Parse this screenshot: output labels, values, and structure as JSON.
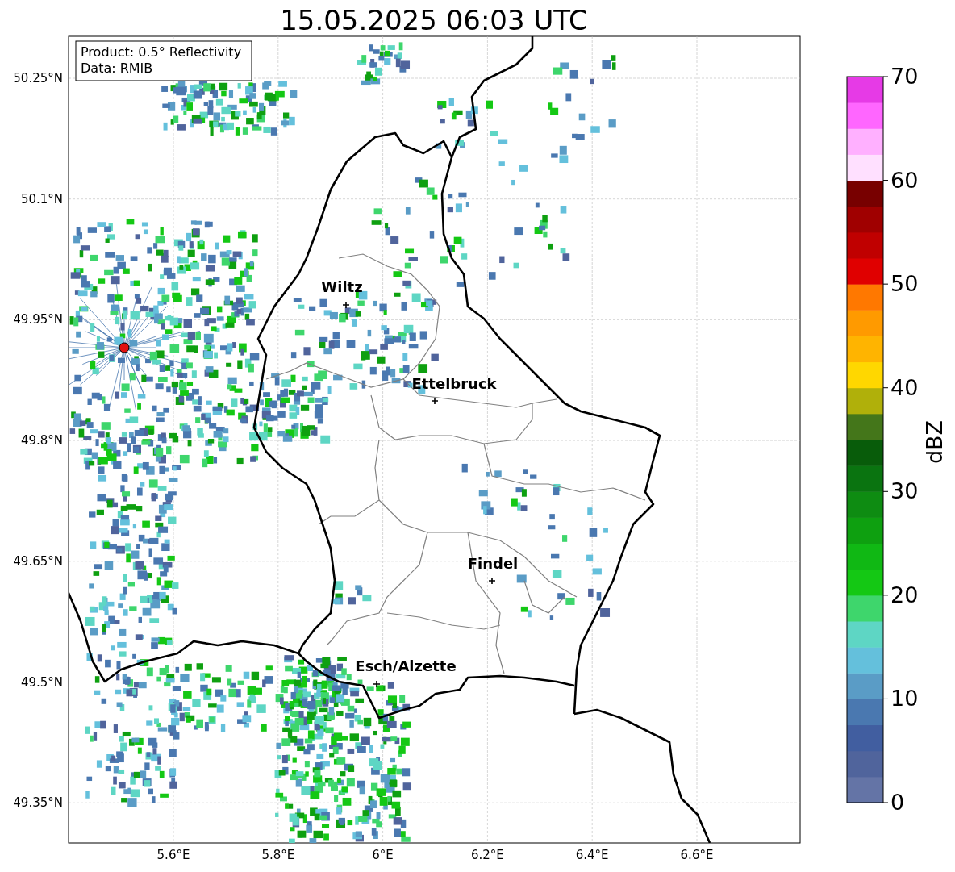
{
  "title": "15.05.2025 06:03 UTC",
  "info_box": {
    "lines": [
      "Product: 0.5° Reflectivity",
      "Data: RMIB"
    ]
  },
  "map": {
    "lat_labels": [
      "50.25°N",
      "50.1°N",
      "49.95°N",
      "49.8°N",
      "49.65°N",
      "49.5°N",
      "49.35°N"
    ],
    "lon_labels": [
      "5.6°E",
      "5.8°E",
      "6°E",
      "6.2°E",
      "6.4°E",
      "6.6°E"
    ],
    "cities": [
      {
        "name": "Wiltz"
      },
      {
        "name": "Ettelbruck"
      },
      {
        "name": "Findel"
      },
      {
        "name": "Esch/Alzette"
      }
    ]
  },
  "colorbar": {
    "label": "dBZ",
    "tick_labels": [
      "70",
      "60",
      "50",
      "40",
      "30",
      "20",
      "10",
      "0"
    ],
    "bands": [
      {
        "color": "#6474a6"
      },
      {
        "color": "#50649c"
      },
      {
        "color": "#415ea0"
      },
      {
        "color": "#4a78b0"
      },
      {
        "color": "#5a9cc6"
      },
      {
        "color": "#64c0dc"
      },
      {
        "color": "#5ed6c4"
      },
      {
        "color": "#3ed66c"
      },
      {
        "color": "#14c814"
      },
      {
        "color": "#10b814"
      },
      {
        "color": "#0ea010"
      },
      {
        "color": "#0e8c12"
      },
      {
        "color": "#0a7410"
      },
      {
        "color": "#085c0a"
      },
      {
        "color": "#44761a"
      },
      {
        "color": "#b0b00a"
      },
      {
        "color": "#ffd700"
      },
      {
        "color": "#ffb400"
      },
      {
        "color": "#ff9a00"
      },
      {
        "color": "#ff7800"
      },
      {
        "color": "#e00000"
      },
      {
        "color": "#c00000"
      },
      {
        "color": "#a00000"
      },
      {
        "color": "#780000"
      },
      {
        "color": "#ffe0ff"
      },
      {
        "color": "#ffb0ff"
      },
      {
        "color": "#ff66ff"
      },
      {
        "color": "#e63ae6"
      }
    ]
  }
}
